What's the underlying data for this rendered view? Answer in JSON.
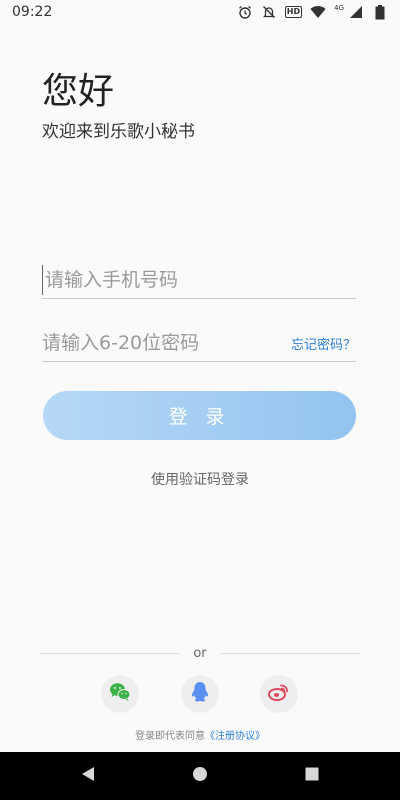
{
  "status_bar": {
    "time": "09:22",
    "hd_label": "HD",
    "network_label": "4G"
  },
  "header": {
    "greeting": "您好",
    "subtitle": "欢迎来到乐歌小秘书"
  },
  "login_form": {
    "phone_placeholder": "请输入手机号码",
    "phone_value": "",
    "password_placeholder": "请输入6-20位密码",
    "password_value": "",
    "forgot_password": "忘记密码？",
    "login_button": "登 录",
    "sms_login": "使用验证码登录"
  },
  "alt_login": {
    "or_text": "or",
    "providers": [
      "wechat",
      "qq",
      "weibo"
    ]
  },
  "agreement": {
    "prefix": "登录即代表同意",
    "link": "《注册协议》"
  },
  "colors": {
    "accent": "#2b7fd4",
    "button_start": "#b6d8f7",
    "button_end": "#93c4ef",
    "wechat": "#3cb24a",
    "qq": "#5b8ff0",
    "weibo": "#e2485c"
  }
}
